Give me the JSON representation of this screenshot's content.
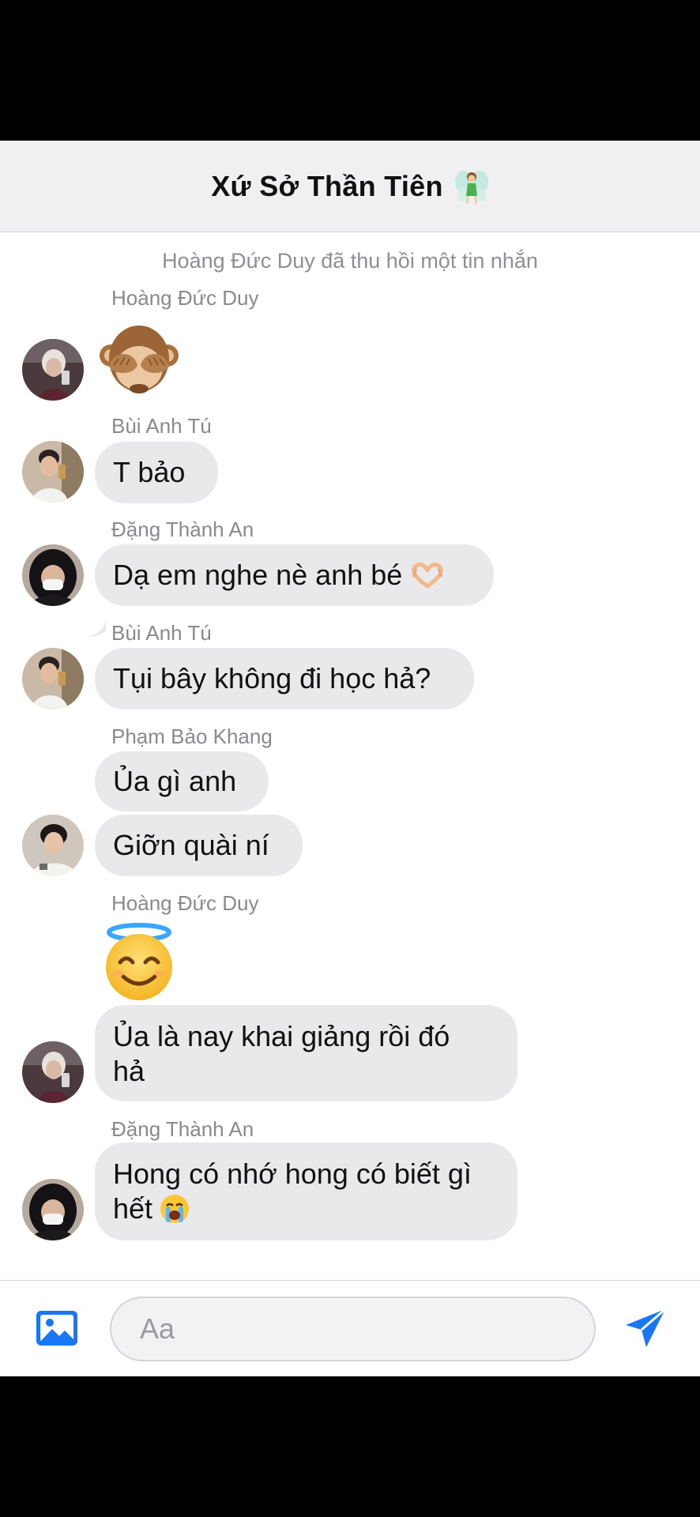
{
  "conversation": {
    "title": "Xứ Sở Thần Tiên",
    "title_emoji": "fairy-emoji"
  },
  "system_notice": "Hoàng Đức Duy đã thu hồi một tin nhắn",
  "messages": [
    {
      "sender": "Hoàng Đức Duy",
      "content_type": "emoji",
      "emoji": "see-no-evil-monkey"
    },
    {
      "sender": "Bùi Anh Tú",
      "text": "T bảo"
    },
    {
      "sender": "Đặng Thành An",
      "text": "Dạ em nghe nè anh bé",
      "trailing_emoji": "heart-hands"
    },
    {
      "sender": "Bùi Anh Tú",
      "text": "Tụi bây không đi học hả?"
    },
    {
      "sender": "Phạm Bảo Khang",
      "text": "Ủa gì anh"
    },
    {
      "sender": "",
      "text": "Giỡn quài ní"
    },
    {
      "sender": "Hoàng Đức Duy",
      "content_type": "emoji",
      "emoji": "smiling-face-with-halo"
    },
    {
      "sender": "",
      "text": "Ủa là nay khai giảng rồi đó hả"
    },
    {
      "sender": "Đặng Thành An",
      "text": "Hong có nhớ hong có biết gì hết",
      "trailing_emoji": "loudly-crying-face"
    }
  ],
  "composer": {
    "placeholder": "Aa",
    "photo_icon": "photo-icon",
    "send_icon": "send-icon"
  },
  "colors": {
    "accent": "#1877f2",
    "bubble": "#e9e9eb",
    "header_bg": "#f0f0f2"
  }
}
